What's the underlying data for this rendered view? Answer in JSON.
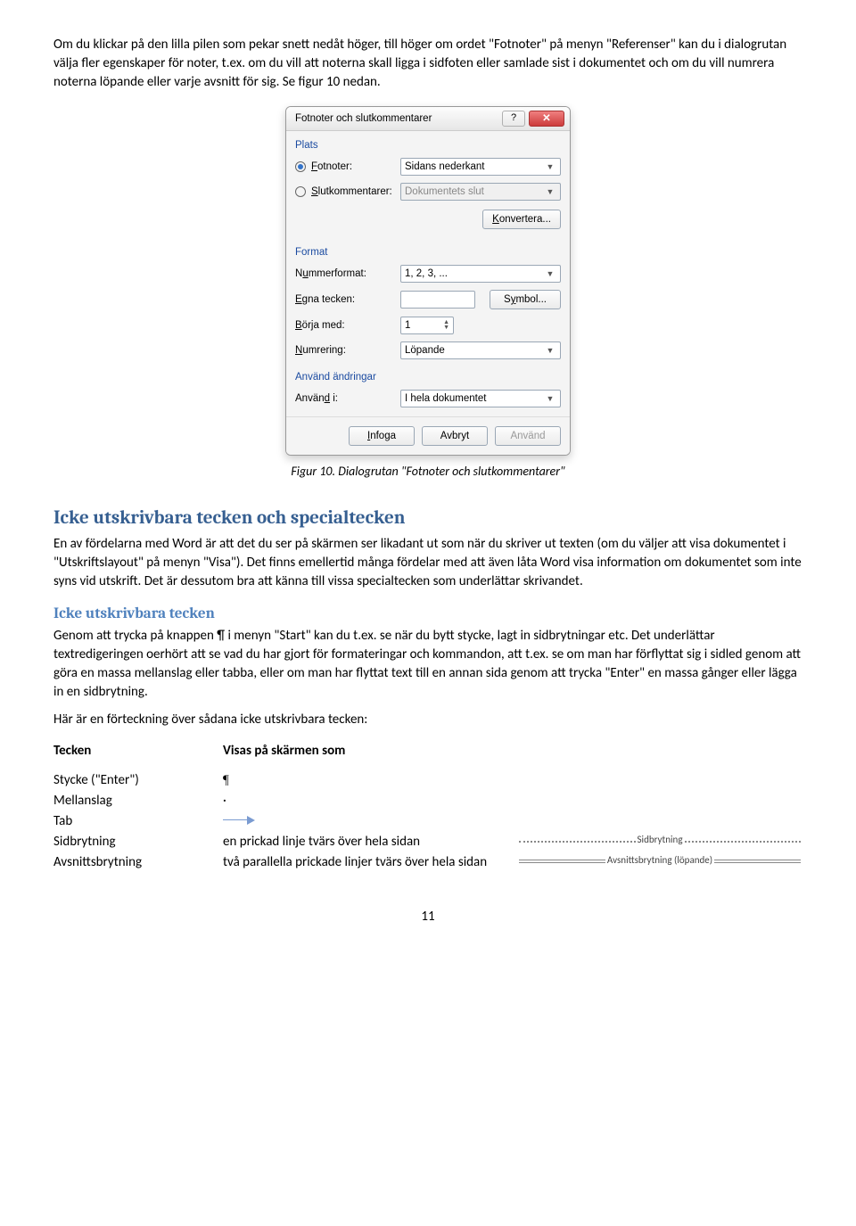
{
  "intro": {
    "p1": "Om du klickar på den lilla pilen som pekar snett nedåt höger, till höger om ordet \"Fotnoter\" på menyn \"Referenser\" kan du i dialogrutan välja fler egenskaper för noter, t.ex. om du vill att noterna skall ligga i sidfoten eller samlade sist i dokumentet och om du vill numrera noterna löpande eller varje avsnitt för sig. Se figur 10 nedan."
  },
  "dialog": {
    "title": "Fotnoter och slutkommentarer",
    "section_plats": "Plats",
    "radio_fotnoter": "Fotnoter:",
    "combo_fotnoter": "Sidans nederkant",
    "radio_slutkom": "Slutkommentarer:",
    "combo_slutkom": "Dokumentets slut",
    "btn_konvertera": "Konvertera...",
    "section_format": "Format",
    "lbl_nummerformat": "Nummerformat:",
    "combo_nummerformat": "1, 2, 3, ...",
    "lbl_egna": "Egna tecken:",
    "btn_symbol": "Symbol...",
    "lbl_borja": "Börja med:",
    "spin_borja": "1",
    "lbl_numrering": "Numrering:",
    "combo_numrering": "Löpande",
    "section_anvand": "Använd ändringar",
    "lbl_anvandi": "Använd i:",
    "combo_anvandi": "I hela dokumentet",
    "btn_infoga": "Infoga",
    "btn_avbryt": "Avbryt",
    "btn_anvand": "Använd"
  },
  "caption": "Figur 10. Dialogrutan \"Fotnoter och slutkommentarer\"",
  "h2": "Icke utskrivbara tecken och specialtecken",
  "p2": "En av fördelarna med Word är att det du ser på skärmen ser likadant ut som när du skriver ut texten (om du väljer att visa dokumentet i \"Utskriftslayout\" på menyn \"Visa\"). Det finns emellertid många fördelar med att även låta Word visa information om dokumentet som inte syns vid utskrift. Det är dessutom bra att känna till vissa specialtecken som underlättar skrivandet.",
  "h3": "Icke utskrivbara tecken",
  "p3": "Genom att trycka på knappen  ¶  i menyn \"Start\" kan du t.ex. se när du bytt stycke, lagt in sidbrytningar etc. Det underlättar textredigeringen oerhört att se vad du har gjort för formateringar och kommandon, att t.ex. se om man har förflyttat sig i sidled genom att göra en massa mellanslag eller tabba, eller om man har flyttat text till en annan sida genom att trycka \"Enter\" en massa gånger eller lägga in en sidbrytning.",
  "p4": "Här är en förteckning över sådana icke utskrivbara tecken:",
  "th1": "Tecken",
  "th2": "Visas på skärmen som",
  "rows": {
    "stycke_lbl": "Stycke (\"Enter\")",
    "stycke_val": "¶",
    "mellanslag_lbl": "Mellanslag",
    "mellanslag_val": "·",
    "tab_lbl": "Tab",
    "sidbryt_lbl": "Sidbrytning",
    "sidbryt_val": "en prickad linje tvärs över hela sidan",
    "sidbryt_gfx": "Sidbrytning",
    "avsnitt_lbl": "Avsnittsbrytning",
    "avsnitt_val": "två parallella prickade linjer tvärs över hela sidan",
    "avsnitt_gfx": "Avsnittsbrytning (löpande)"
  },
  "pagenum": "11"
}
